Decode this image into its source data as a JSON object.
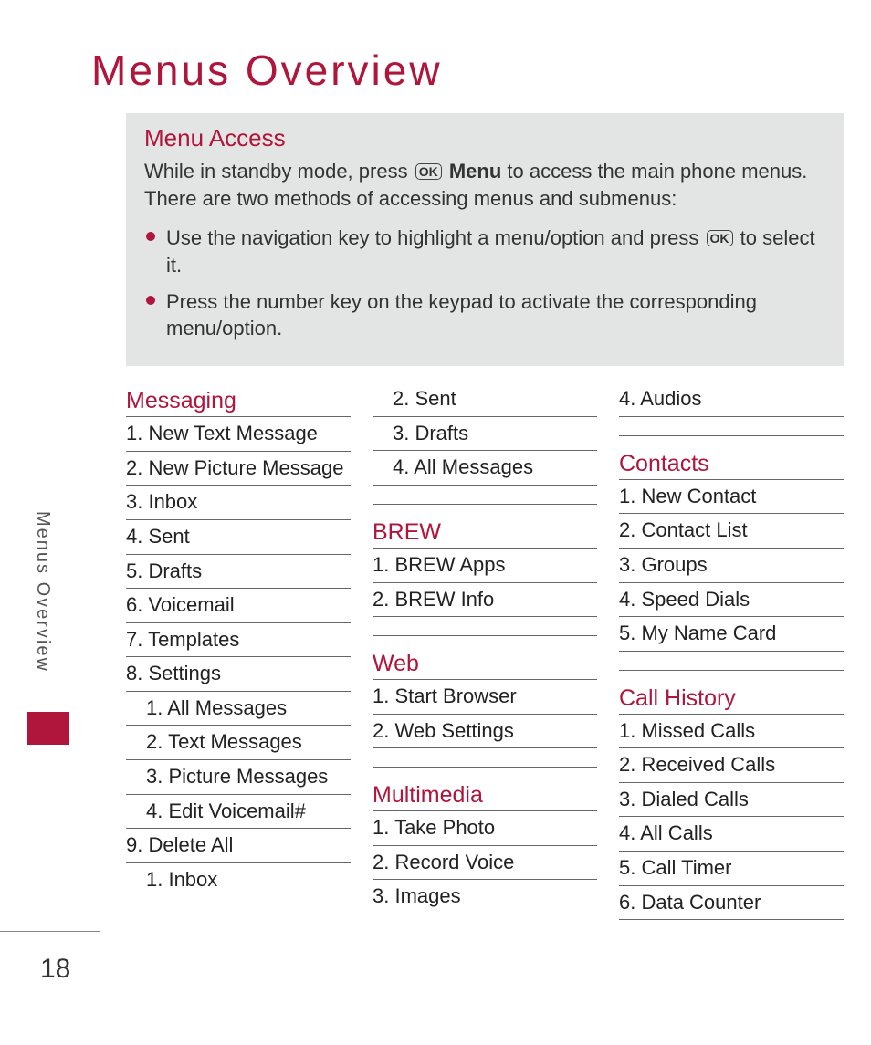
{
  "page_number": "18",
  "side_tab": "Menus Overview",
  "title": "Menus Overview",
  "access": {
    "heading": "Menu Access",
    "intro_before": "While in standby mode, press ",
    "ok_label": "OK",
    "menu_word": "Menu",
    "intro_after": " to access the main phone menus. There are two methods of accessing menus and submenus:",
    "bullet1_before": "Use the navigation key to highlight a menu/option and press ",
    "bullet1_after": " to select it.",
    "bullet2": "Press the number key on the keypad to activate the corresponding menu/option."
  },
  "col1": {
    "messaging": {
      "title": "Messaging",
      "i1": "1. New Text Message",
      "i2": "2. New Picture Message",
      "i3": "3. Inbox",
      "i4": "4. Sent",
      "i5": "5. Drafts",
      "i6": "6. Voicemail",
      "i7": "7.  Templates",
      "i8": "8. Settings",
      "s81": "1. All Messages",
      "s82": "2. Text Messages",
      "s83": "3. Picture Messages",
      "s84": "4. Edit Voicemail#",
      "i9": "9. Delete All",
      "s91": "1. Inbox"
    }
  },
  "col2": {
    "delete_cont": {
      "i2": "2. Sent",
      "i3": "3. Drafts",
      "i4": "4. All Messages"
    },
    "brew": {
      "title": "BREW",
      "i1": "1. BREW Apps",
      "i2": "2. BREW Info"
    },
    "web": {
      "title": "Web",
      "i1": "1. Start Browser",
      "i2": "2. Web Settings"
    },
    "multimedia": {
      "title": "Multimedia",
      "i1": "1. Take Photo",
      "i2": "2. Record Voice",
      "i3": "3. Images"
    }
  },
  "col3": {
    "multimedia_cont": {
      "i4": "4. Audios"
    },
    "contacts": {
      "title": "Contacts",
      "i1": "1. New Contact",
      "i2": "2. Contact List",
      "i3": "3. Groups",
      "i4": "4. Speed Dials",
      "i5": "5. My Name Card"
    },
    "callhistory": {
      "title": "Call History",
      "i1": "1. Missed Calls",
      "i2": "2. Received Calls",
      "i3": "3. Dialed Calls",
      "i4": "4. All Calls",
      "i5": "5. Call Timer",
      "i6": "6. Data Counter"
    }
  }
}
